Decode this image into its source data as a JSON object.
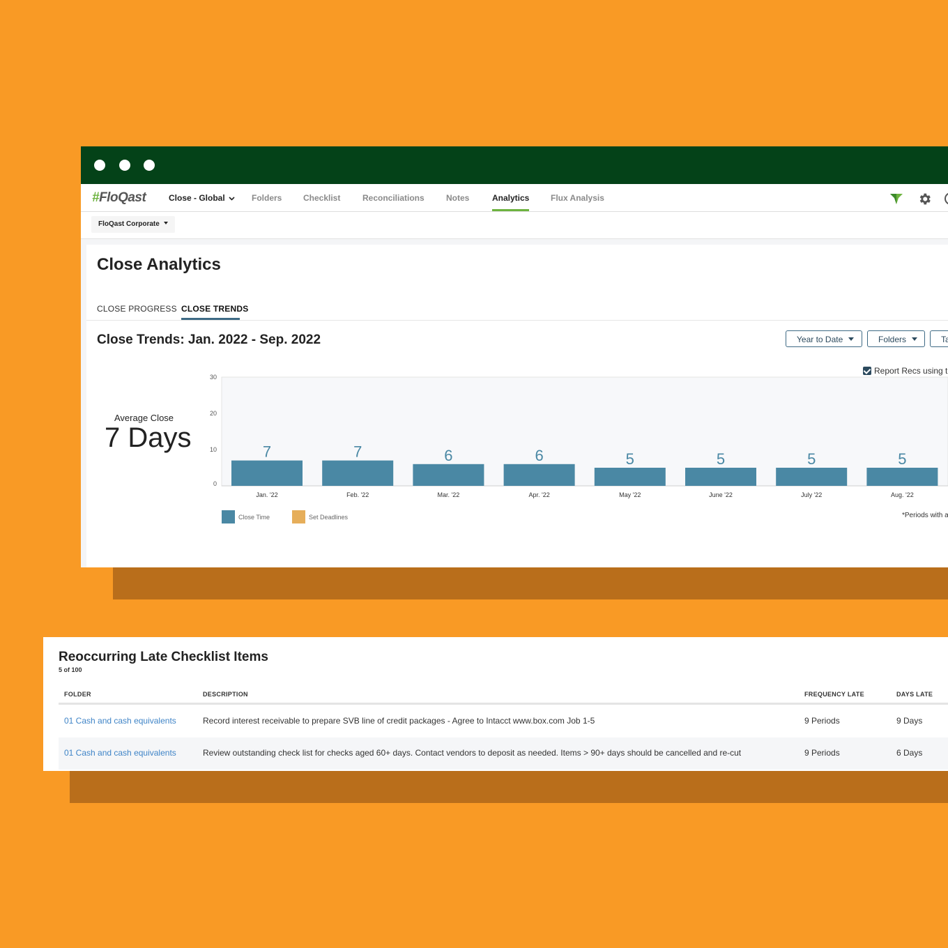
{
  "app": {
    "logo_text": "FloQast",
    "nav": {
      "close_label": "Close - Global",
      "folders": "Folders",
      "checklist": "Checklist",
      "reconciliations": "Reconciliations",
      "notes": "Notes",
      "analytics": "Analytics",
      "flux_analysis": "Flux Analysis"
    },
    "entity": "FloQast Corporate"
  },
  "analytics": {
    "title": "Close Analytics",
    "tabs": [
      "CLOSE PROGRESS",
      "CLOSE TRENDS"
    ],
    "active_tab": "CLOSE TRENDS",
    "section_title": "Close Trends: Jan. 2022 - Sep. 2022",
    "filters": {
      "period": "Year to Date",
      "folders": "Folders",
      "third": "Ta"
    },
    "report_checkbox_label": "Report Recs using th",
    "average": {
      "label": "Average Close",
      "value": "7 Days"
    },
    "footnote": "*Periods with a"
  },
  "chart_data": {
    "type": "bar",
    "categories": [
      "Jan. '22",
      "Feb. '22",
      "Mar. '22",
      "Apr. '22",
      "May '22",
      "June '22",
      "July '22",
      "Aug. '22"
    ],
    "series": [
      {
        "name": "Close Time",
        "values": [
          7,
          7,
          6,
          6,
          5,
          5,
          5,
          5
        ],
        "color": "#4A88A4"
      },
      {
        "name": "Set Deadlines",
        "values": [],
        "color": "#E6AE5A"
      }
    ],
    "yticks": [
      0,
      10,
      20,
      30
    ],
    "ylim": [
      0,
      30
    ],
    "grid": false,
    "legend_position": "bottom-left"
  },
  "late_items": {
    "title": "Reoccurring Late Checklist Items",
    "count": "5 of 100",
    "columns": {
      "folder": "FOLDER",
      "description": "DESCRIPTION",
      "frequency": "FREQUENCY LATE",
      "days": "DAYS LATE"
    },
    "rows": [
      {
        "folder": "01 Cash and cash equivalents",
        "description": "Record interest receivable to prepare SVB line of credit packages - Agree to Intacct www.box.com Job 1-5",
        "frequency": "9 Periods",
        "days": "9 Days"
      },
      {
        "folder": "01 Cash and cash equivalents",
        "description": "Review outstanding check list for checks aged 60+ days. Contact vendors to deposit as needed. Items > 90+ days should be cancelled and re-cut",
        "frequency": "9 Periods",
        "days": "6 Days"
      }
    ]
  },
  "colors": {
    "background": "#F99A25",
    "titlebar": "#044218",
    "accent_green": "#6DB33F",
    "bar": "#4A88A4",
    "deadline": "#E6AE5A",
    "link": "#3F84C7"
  }
}
